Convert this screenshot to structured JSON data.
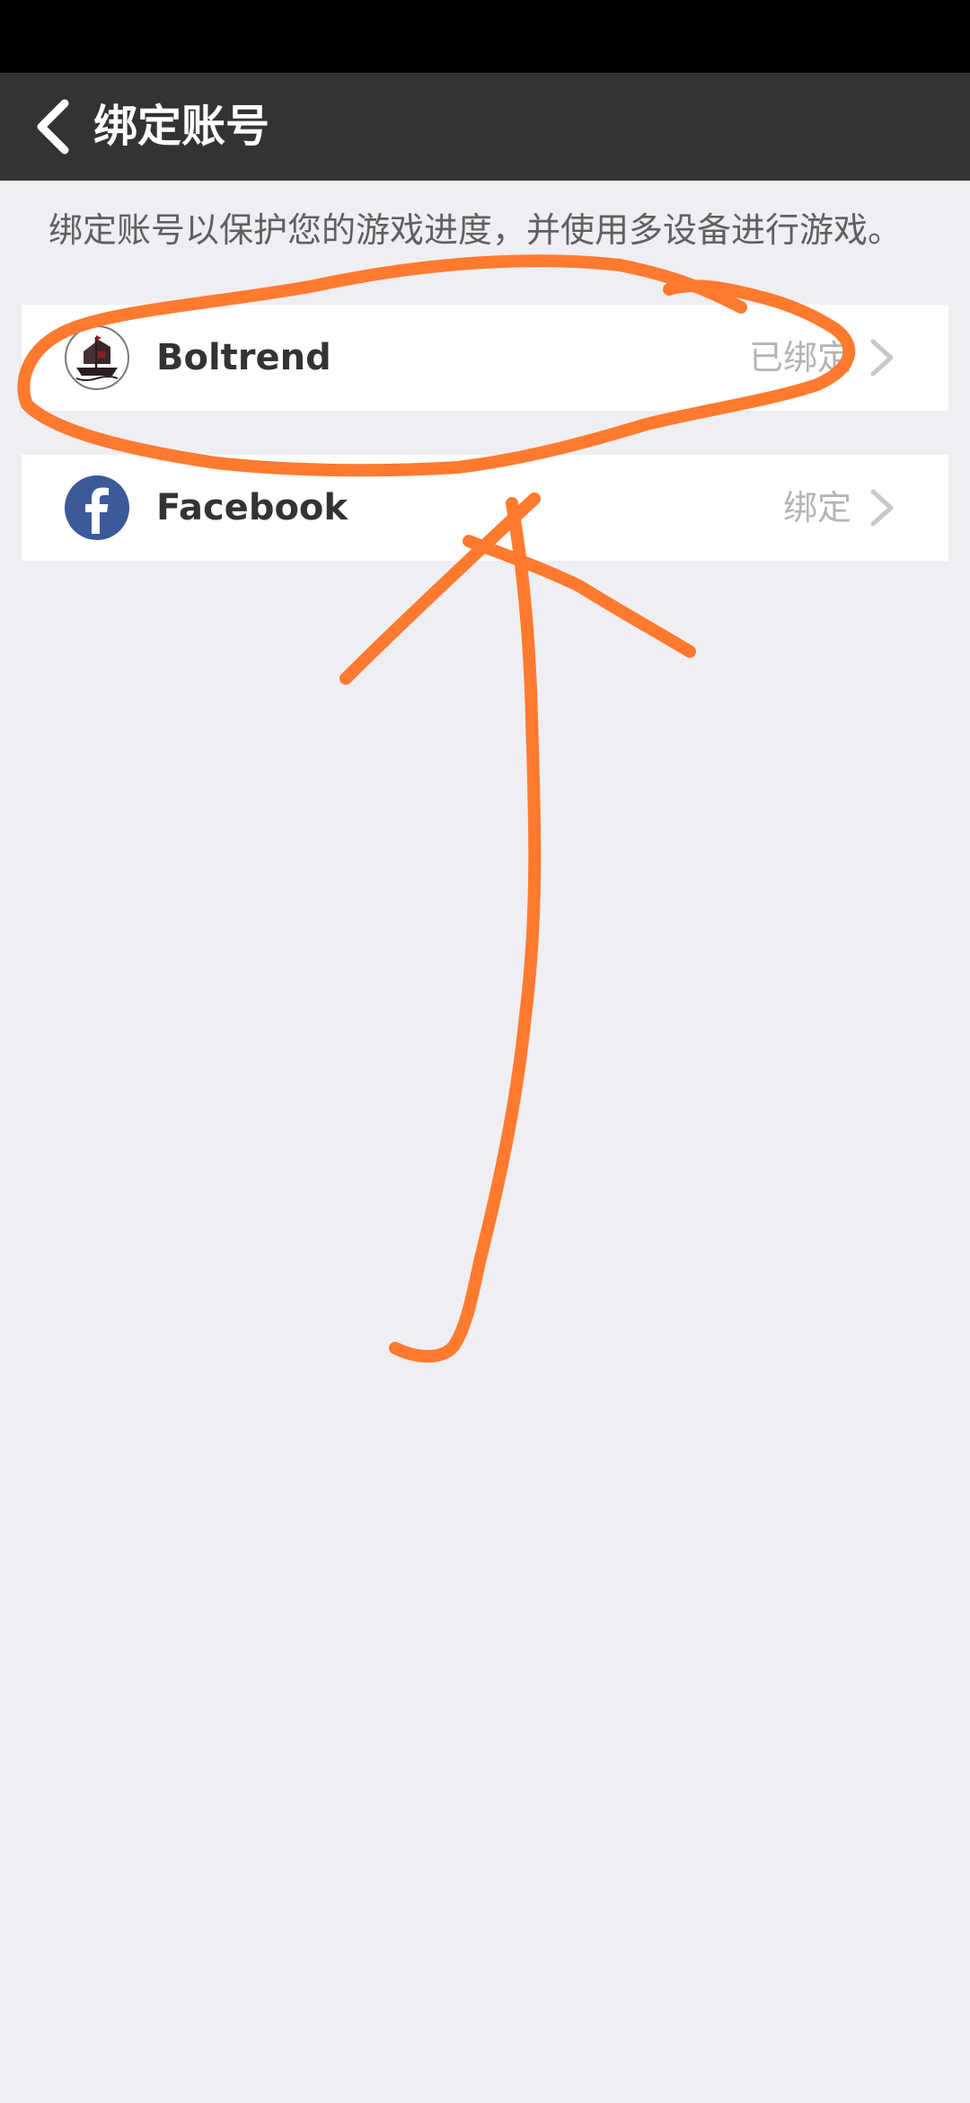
{
  "header": {
    "title": "绑定账号",
    "back_icon": "chevron-left-icon"
  },
  "description": "绑定账号以保护您的游戏进度，并使用多设备进行游戏。",
  "accounts": [
    {
      "name": "Boltrend",
      "status": "已绑定",
      "icon": "pirate-ship-logo-icon"
    },
    {
      "name": "Facebook",
      "status": "绑定",
      "icon": "facebook-logo-icon"
    }
  ],
  "colors": {
    "status_bar": "#000000",
    "header_bg": "#333333",
    "page_bg": "#efeef3",
    "row_bg": "#ffffff",
    "facebook_blue": "#3b5a9a",
    "annotation": "#ff7a2f"
  }
}
